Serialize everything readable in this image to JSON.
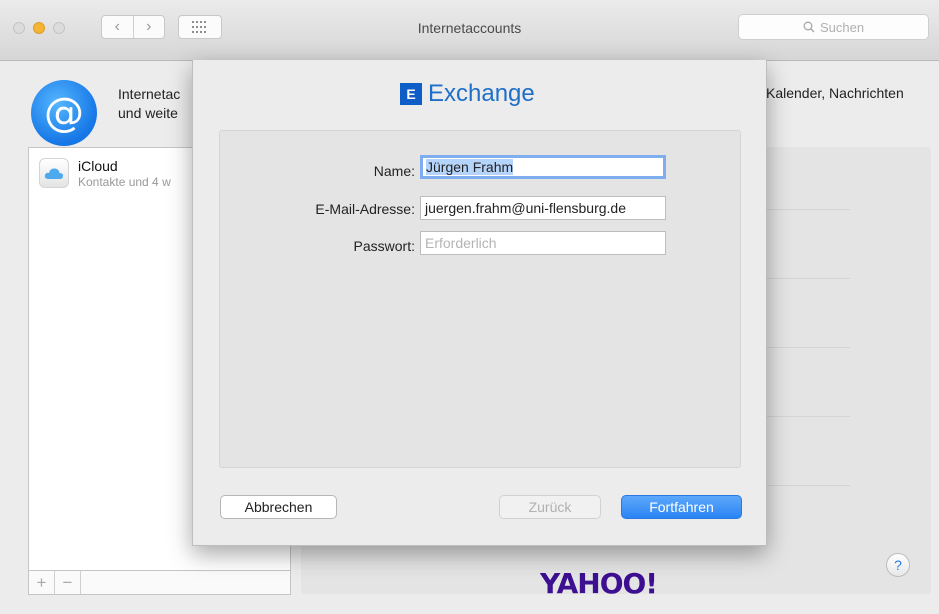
{
  "window": {
    "title": "Internetaccounts",
    "search_placeholder": "Suchen",
    "nav_back": "‹",
    "nav_forward": "›"
  },
  "header": {
    "description_left_line1": "Internetac",
    "description_left_line2": "und weite",
    "description_right": "Kalender, Nachrichten"
  },
  "sidebar": {
    "accounts": [
      {
        "name": "iCloud",
        "subtitle": "Kontakte und 4 w"
      }
    ],
    "add_label": "+",
    "remove_label": "−"
  },
  "right_pane": {
    "provider_visible": "YAHOO!",
    "help_label": "?"
  },
  "sheet": {
    "logo_mark": "E",
    "logo_text": "Exchange",
    "fields": {
      "name_label": "Name:",
      "name_value": "Jürgen Frahm",
      "email_label": "E-Mail-Adresse:",
      "email_value": "juergen.frahm@uni-flensburg.de",
      "password_label": "Passwort:",
      "password_placeholder": "Erforderlich"
    },
    "buttons": {
      "cancel": "Abbrechen",
      "back": "Zurück",
      "continue": "Fortfahren"
    }
  },
  "colors": {
    "accent_blue": "#2b84f4",
    "exchange_blue": "#0e5ec7",
    "yahoo_purple": "#3d0f91",
    "minimize_yellow": "#f5b531"
  }
}
